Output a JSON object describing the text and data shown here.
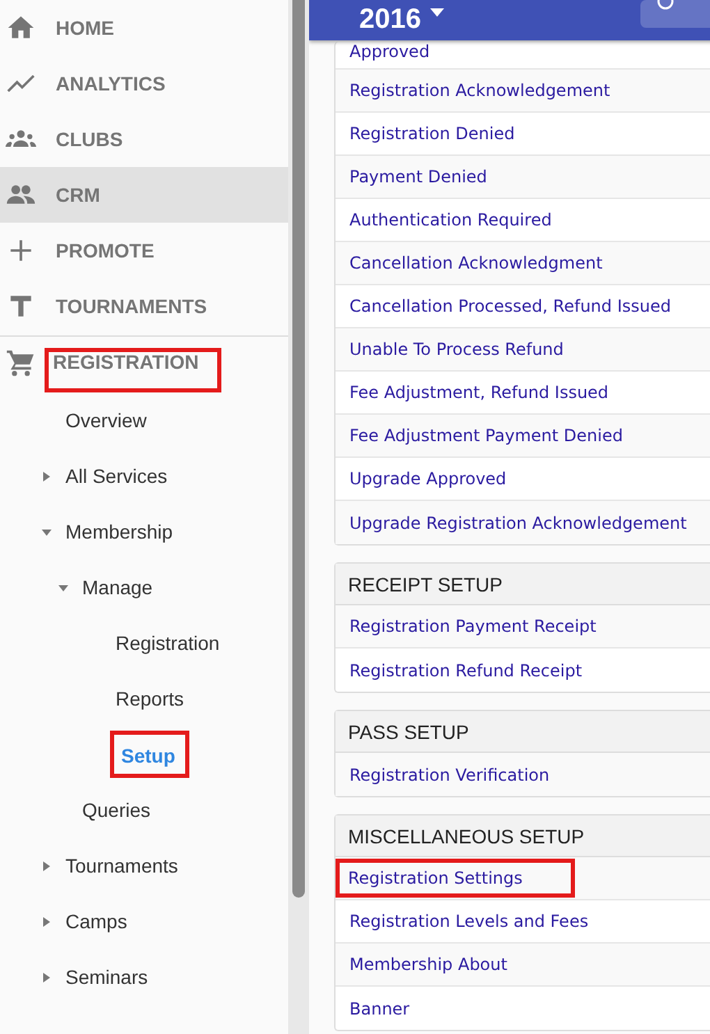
{
  "nav": [
    {
      "label": "HOME",
      "selected": false
    },
    {
      "label": "ANALYTICS",
      "selected": false
    },
    {
      "label": "CLUBS",
      "selected": false
    },
    {
      "label": "CRM",
      "selected": true
    },
    {
      "label": "PROMOTE",
      "selected": false
    },
    {
      "label": "TOURNAMENTS",
      "selected": false
    }
  ],
  "section": {
    "label": "REGISTRATION",
    "highlighted": true,
    "tree": [
      {
        "label": "Overview",
        "kind": "link",
        "selected": false,
        "highlighted": false
      },
      {
        "label": "All Services",
        "kind": "group",
        "expanded": false,
        "selected": false,
        "highlighted": false
      },
      {
        "label": "Membership",
        "kind": "group",
        "expanded": true,
        "selected": false,
        "highlighted": false,
        "children": [
          {
            "label": "Manage",
            "kind": "group",
            "expanded": true,
            "selected": false,
            "highlighted": false,
            "children": [
              {
                "label": "Registration",
                "kind": "link",
                "selected": false,
                "highlighted": false
              },
              {
                "label": "Reports",
                "kind": "link",
                "selected": false,
                "highlighted": false
              },
              {
                "label": "Setup",
                "kind": "link",
                "selected": true,
                "highlighted": true
              }
            ]
          },
          {
            "label": "Queries",
            "kind": "link",
            "selected": false,
            "highlighted": false
          }
        ]
      },
      {
        "label": "Tournaments",
        "kind": "group",
        "expanded": false,
        "selected": false,
        "highlighted": false
      },
      {
        "label": "Camps",
        "kind": "group",
        "expanded": false,
        "selected": false,
        "highlighted": false
      },
      {
        "label": "Seminars",
        "kind": "group",
        "expanded": false,
        "selected": false,
        "highlighted": false
      }
    ]
  },
  "header": {
    "year": "2016"
  },
  "cards": [
    {
      "links": [
        {
          "label": "Approved",
          "highlighted": false
        },
        {
          "label": "Registration Acknowledgement",
          "highlighted": false
        },
        {
          "label": "Registration Denied",
          "highlighted": false
        },
        {
          "label": "Payment Denied",
          "highlighted": false
        },
        {
          "label": "Authentication Required",
          "highlighted": false
        },
        {
          "label": "Cancellation Acknowledgment",
          "highlighted": false
        },
        {
          "label": "Cancellation Processed, Refund Issued",
          "highlighted": false
        },
        {
          "label": "Unable To Process Refund",
          "highlighted": false
        },
        {
          "label": "Fee Adjustment, Refund Issued",
          "highlighted": false
        },
        {
          "label": "Fee Adjustment Payment Denied",
          "highlighted": false
        },
        {
          "label": "Upgrade Approved",
          "highlighted": false
        },
        {
          "label": "Upgrade Registration Acknowledgement",
          "highlighted": false
        }
      ]
    },
    {
      "title": "RECEIPT SETUP",
      "links": [
        {
          "label": "Registration Payment Receipt",
          "highlighted": false
        },
        {
          "label": "Registration Refund Receipt",
          "highlighted": false
        }
      ]
    },
    {
      "title": "PASS SETUP",
      "links": [
        {
          "label": "Registration Verification",
          "highlighted": false
        }
      ]
    },
    {
      "title": "MISCELLANEOUS SETUP",
      "links": [
        {
          "label": "Registration Settings",
          "highlighted": true
        },
        {
          "label": "Registration Levels and Fees",
          "highlighted": false
        },
        {
          "label": "Membership About",
          "highlighted": false
        },
        {
          "label": "Banner",
          "highlighted": false
        }
      ]
    }
  ]
}
